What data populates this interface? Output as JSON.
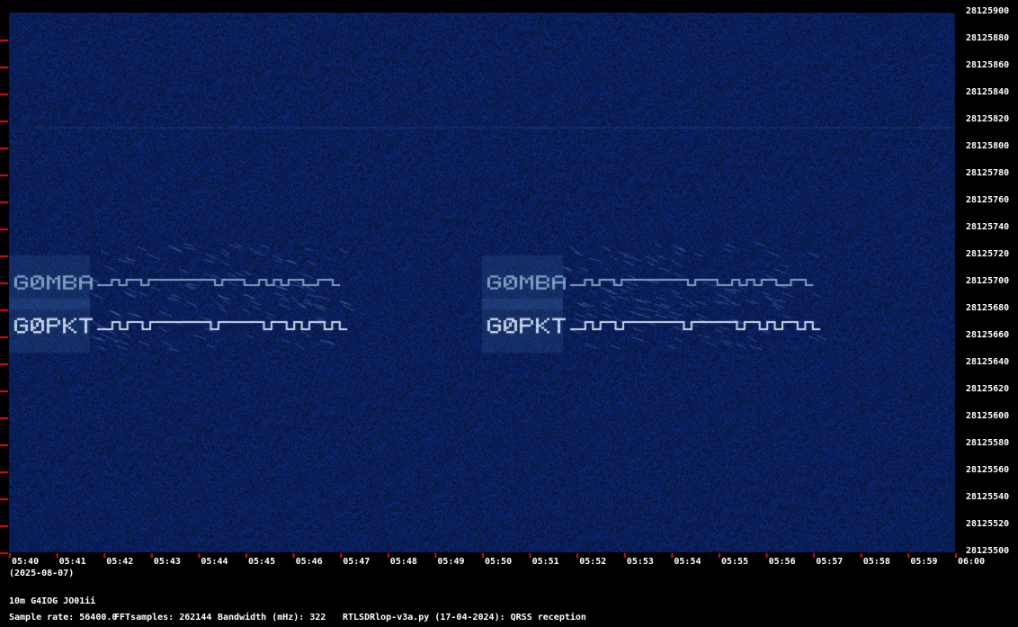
{
  "chart_data": {
    "type": "heatmap",
    "y_ticks": [
      "28125900",
      "28125880",
      "28125860",
      "28125840",
      "28125820",
      "28125800",
      "28125780",
      "28125760",
      "28125740",
      "28125720",
      "28125700",
      "28125680",
      "28125660",
      "28125640",
      "28125620",
      "28125600",
      "28125580",
      "28125560",
      "28125540",
      "28125520",
      "28125500"
    ],
    "ylim": [
      28125500,
      28125900
    ],
    "x_ticks": [
      "05:40",
      "05:41",
      "05:42",
      "05:43",
      "05:44",
      "05:45",
      "05:46",
      "05:47",
      "05:48",
      "05:49",
      "05:50",
      "05:51",
      "05:52",
      "05:53",
      "05:54",
      "05:55",
      "05:56",
      "05:57",
      "05:58",
      "05:59",
      "06:00"
    ],
    "date": "(2025-08-07)",
    "signals": [
      {
        "callsign": "G0MBA",
        "freq_hz": 28125700,
        "start": "05:40",
        "end": "05:47"
      },
      {
        "callsign": "G0PKT",
        "freq_hz": 28125668,
        "start": "05:40",
        "end": "05:47"
      },
      {
        "callsign": "G0MBA",
        "freq_hz": 28125700,
        "start": "05:50",
        "end": "05:57"
      },
      {
        "callsign": "G0PKT",
        "freq_hz": 28125668,
        "start": "05:50",
        "end": "05:57"
      }
    ],
    "colors": {
      "background": "#0b1f5c",
      "signal": "#c9ddf0",
      "tick": "#e01010"
    }
  },
  "footer": {
    "station": "10m G4IOG JO01ii",
    "sample_rate": "Sample rate: 56400.0",
    "fft_samples": "FFTsamples: 262144",
    "bandwidth": "Bandwidth (mHz): 322",
    "program": "RTLSDRlop-v3a.py (17-04-2024): QRSS reception"
  }
}
